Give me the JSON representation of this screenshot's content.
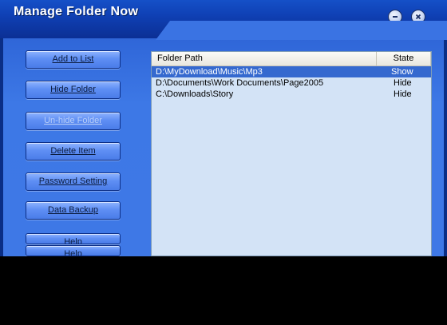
{
  "window": {
    "title": "Manage Folder Now",
    "minimize_icon": "minimize-icon",
    "close_icon": "close-icon"
  },
  "sidebar": {
    "buttons": [
      {
        "label": "Add to List",
        "enabled": true
      },
      {
        "label": "Hide Folder",
        "enabled": true
      },
      {
        "label": "Un-hide Folder",
        "enabled": false
      },
      {
        "label": "Delete Item",
        "enabled": true
      },
      {
        "label": "Password Setting",
        "enabled": true
      },
      {
        "label": "Data Backup",
        "enabled": true
      },
      {
        "label": "Help",
        "enabled": true
      },
      {
        "label": "Help",
        "enabled": true
      }
    ]
  },
  "list": {
    "columns": [
      "Folder Path",
      "State"
    ],
    "rows": [
      {
        "path": "D:\\MyDownload\\Music\\Mp3",
        "state": "Show",
        "selected": true
      },
      {
        "path": "D:\\Documents\\Work Documents\\Page2005",
        "state": "Hide",
        "selected": false
      },
      {
        "path": "C:\\Downloads\\Story",
        "state": "Hide",
        "selected": false
      }
    ]
  },
  "colors": {
    "titlebar": "#0F40B4",
    "client": "#3D78E6",
    "list_bg": "#D3E3F6",
    "selection": "#3569CF"
  }
}
